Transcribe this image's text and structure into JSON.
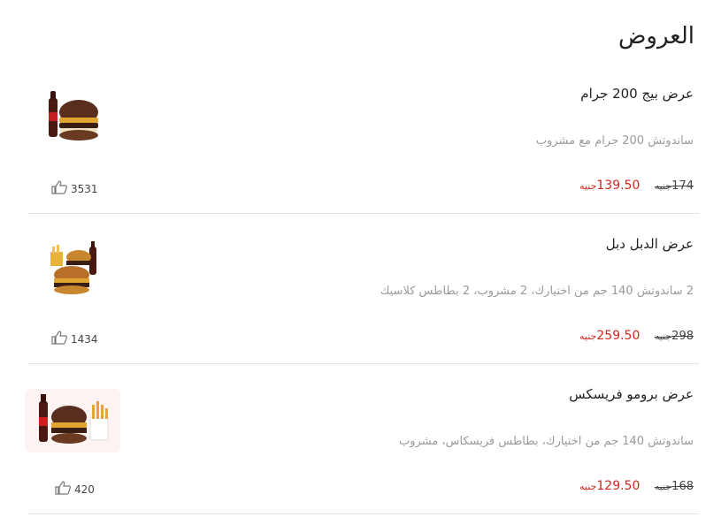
{
  "section": {
    "title": "العروض"
  },
  "offers": [
    {
      "name": "عرض بيج 200 جرام",
      "description": "ساندوتش 200 جرام مع مشروب",
      "old_price": "174",
      "old_currency": "جنيه",
      "new_price": "139.50",
      "new_currency": "جنيه",
      "likes": "3531",
      "image": "burger-with-cola-icon"
    },
    {
      "name": "عرض الدبل دبل",
      "description": "2 ساندوتش 140 جم من اختيارك، 2 مشروب، 2 بطاطس كلاسيك",
      "old_price": "298",
      "old_currency": "جنيه",
      "new_price": "259.50",
      "new_currency": "جنيه",
      "likes": "1434",
      "image": "double-burger-meal-icon"
    },
    {
      "name": "عرض برومو فريسكس",
      "description": "ساندوتش 140 جم من اختيارك، بطاطس فريسكاس، مشروب",
      "old_price": "168",
      "old_currency": "جنيه",
      "new_price": "129.50",
      "new_currency": "جنيه",
      "likes": "420",
      "image": "burger-fries-cola-icon"
    }
  ]
}
